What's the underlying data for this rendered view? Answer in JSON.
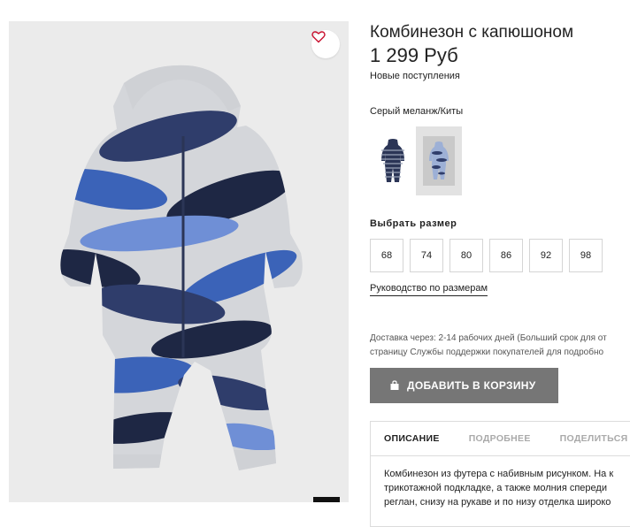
{
  "product": {
    "title": "Комбинезон с капюшоном",
    "price": "1 299 Руб",
    "badge": "Новые поступления",
    "color_name": "Серый меланж/Киты",
    "swatches": [
      {
        "name": "striped-navy",
        "selected": false
      },
      {
        "name": "whale-print",
        "selected": true
      }
    ],
    "size_label": "Выбрать размер",
    "sizes": [
      "68",
      "74",
      "80",
      "86",
      "92",
      "98"
    ],
    "size_guide": "Руководство по размерам",
    "delivery_line1": "Доставка через: 2-14 рабочих дней (Больший срок для от",
    "delivery_line2": "страницу Службы поддержки покупателей для подробно",
    "add_to_cart": "ДОБАВИТЬ В КОРЗИНУ",
    "tabs": [
      "ОПИСАНИЕ",
      "ПОДРОБНЕЕ",
      "ПОДЕЛИТЬСЯ"
    ],
    "active_tab": "ОПИСАНИЕ",
    "description_lines": [
      "Комбинезон из футера с набивным рисунком. На к",
      "трикотажной подкладке, а также молния спереди",
      "реглан, снизу на рукаве и по низу отделка широко"
    ]
  },
  "icons": {
    "favorite": "heart-icon",
    "cart": "shopping-bag-icon"
  },
  "colors": {
    "accent_heart": "#c8102e",
    "button_bg": "#767676",
    "image_bg": "#ebebeb"
  }
}
